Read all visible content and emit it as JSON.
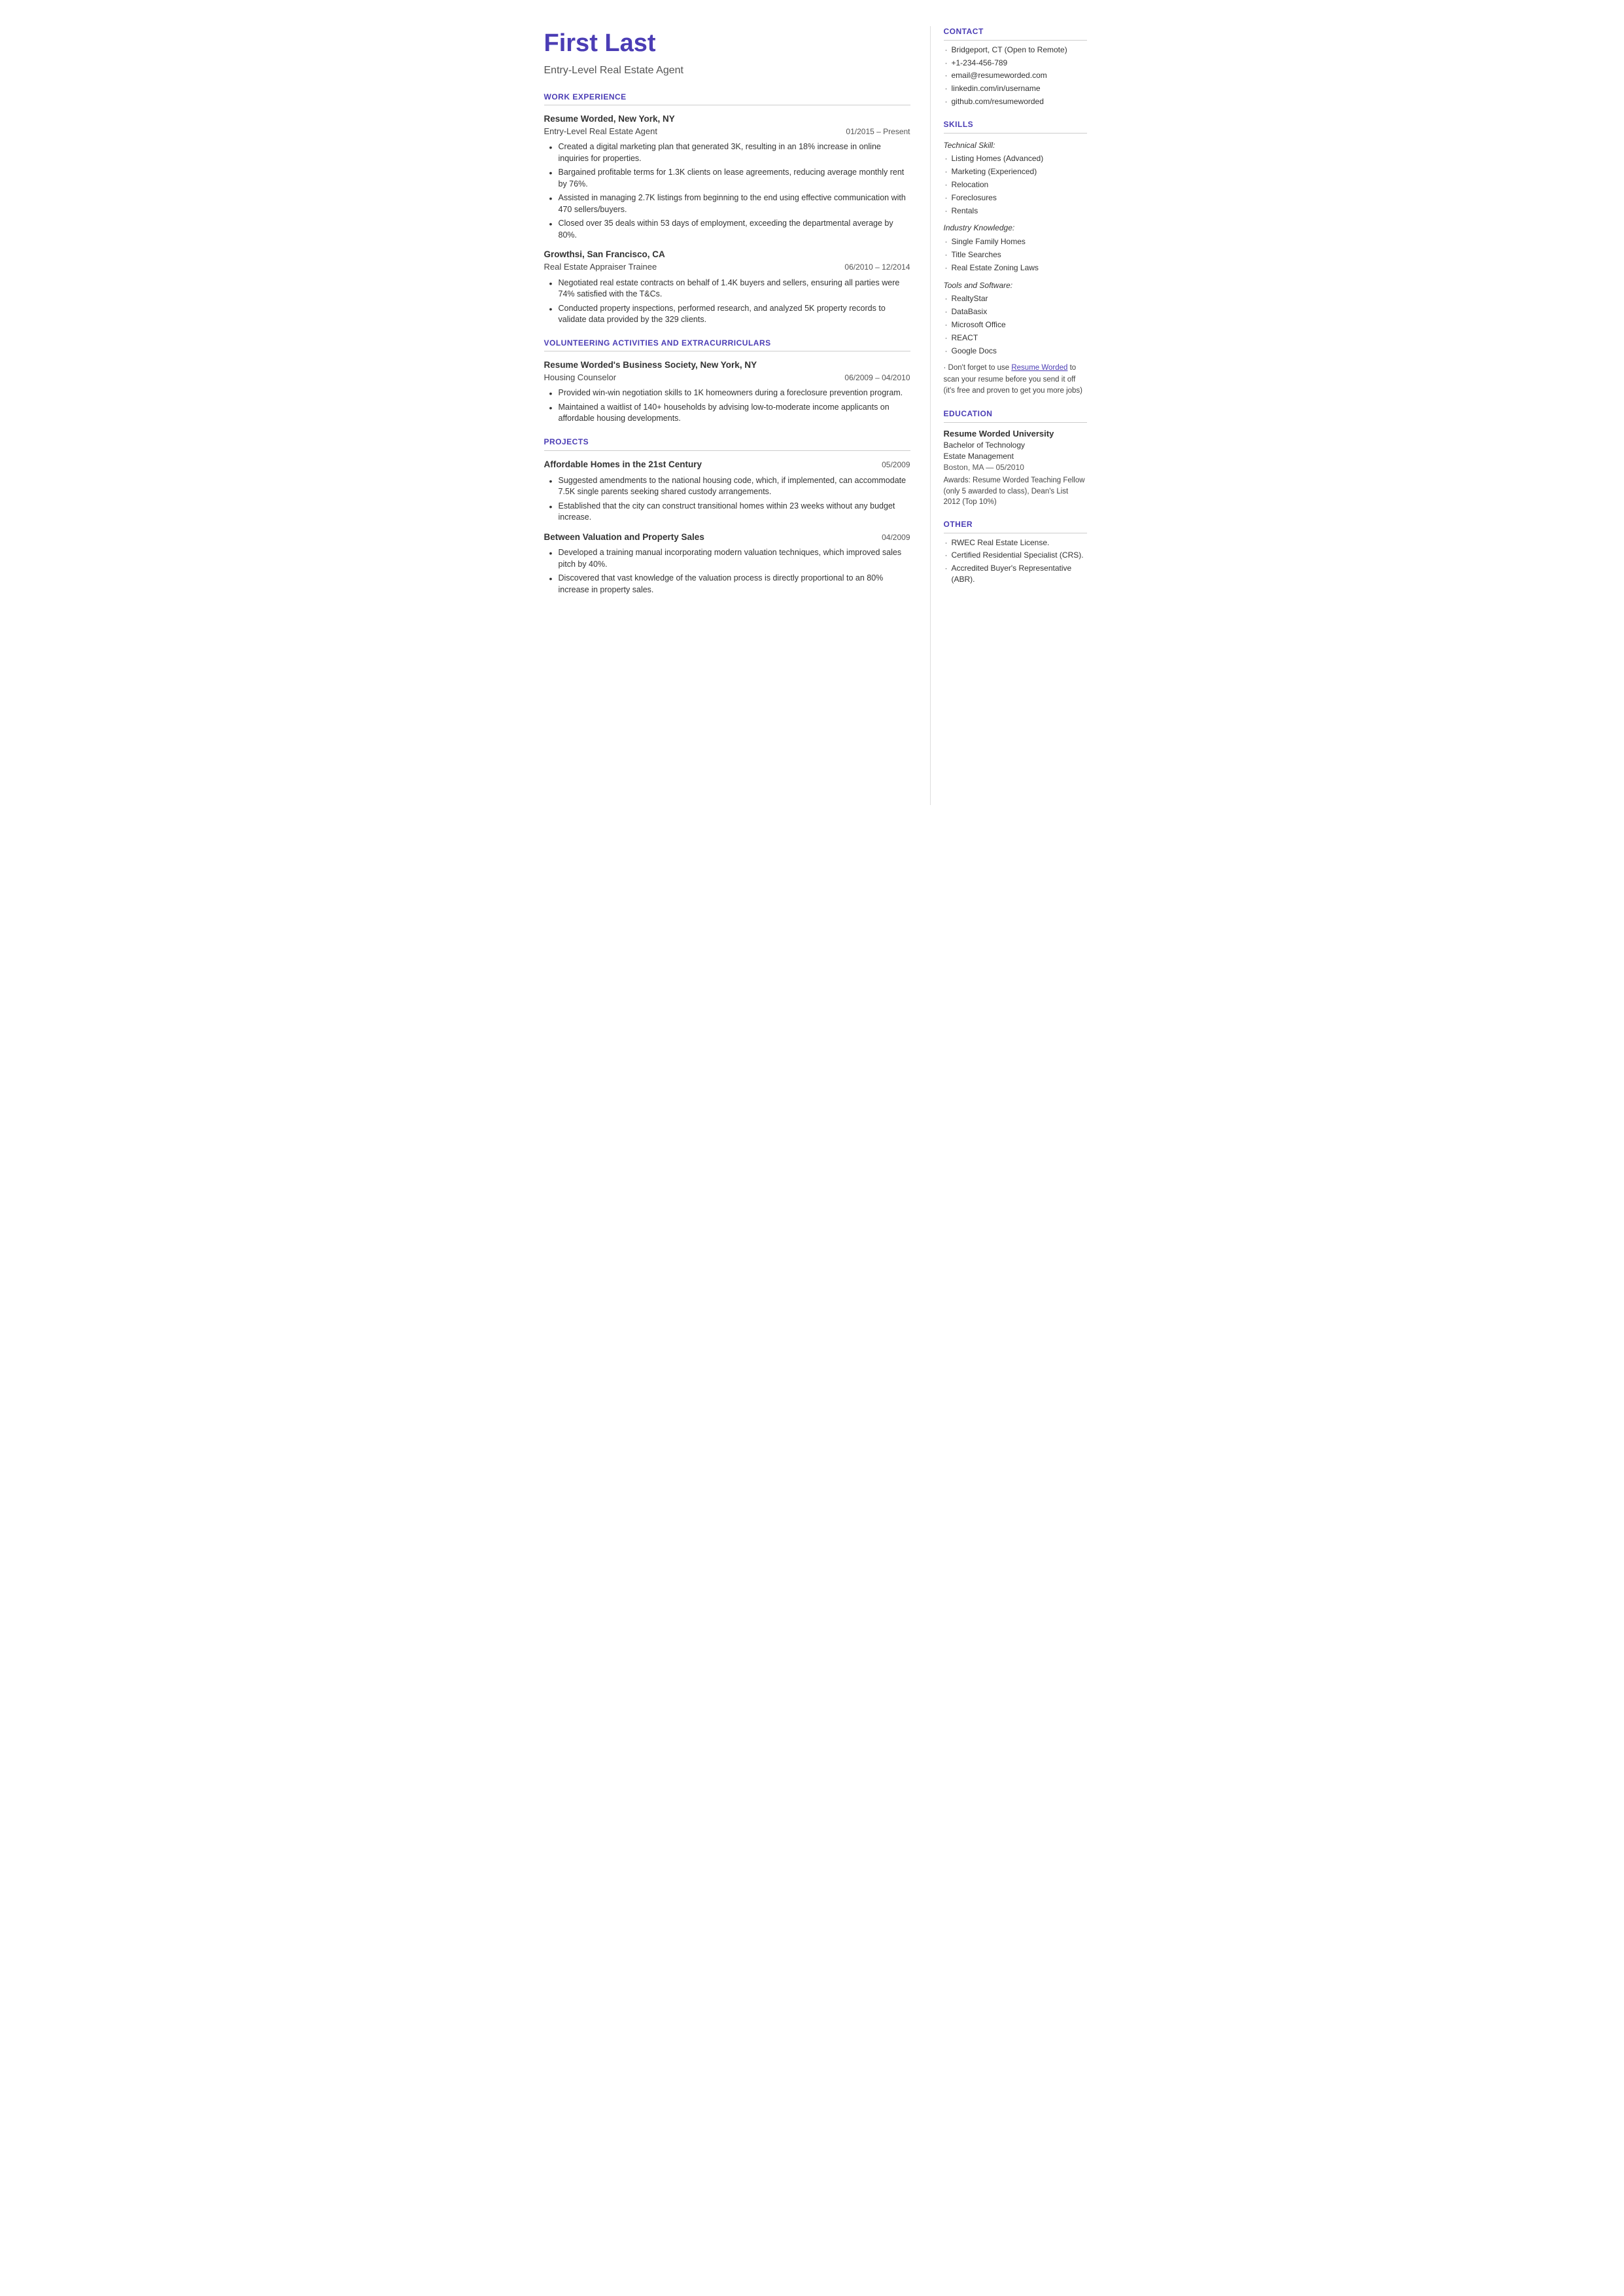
{
  "header": {
    "name": "First Last",
    "title": "Entry-Level Real Estate Agent"
  },
  "sections": {
    "work_experience_label": "WORK EXPERIENCE",
    "volunteering_label": "VOLUNTEERING ACTIVITIES AND EXTRACURRICULARS",
    "projects_label": "PROJECTS"
  },
  "jobs": [
    {
      "company": "Resume Worded, New York, NY",
      "role": "Entry-Level Real Estate Agent",
      "dates": "01/2015 – Present",
      "bullets": [
        "Created a digital marketing plan that generated 3K, resulting in an 18% increase in online inquiries for properties.",
        "Bargained profitable terms for 1.3K clients on lease agreements, reducing average monthly rent by 76%.",
        "Assisted in managing 2.7K listings from beginning to the end using effective communication with 470 sellers/buyers.",
        "Closed over 35 deals within 53 days of employment, exceeding the departmental average by 80%."
      ]
    },
    {
      "company": "Growthsi, San Francisco, CA",
      "role": "Real Estate Appraiser Trainee",
      "dates": "06/2010 – 12/2014",
      "bullets": [
        "Negotiated real estate contracts on behalf of 1.4K buyers and sellers, ensuring all parties were 74% satisfied with the T&Cs.",
        "Conducted property inspections, performed research, and analyzed 5K property records to validate data provided by the 329 clients."
      ]
    }
  ],
  "volunteering": [
    {
      "company": "Resume Worded's Business Society, New York, NY",
      "role": "Housing Counselor",
      "dates": "06/2009 – 04/2010",
      "bullets": [
        "Provided win-win negotiation skills to 1K homeowners during a foreclosure prevention program.",
        "Maintained a waitlist of 140+ households by advising low-to-moderate income applicants on affordable housing developments."
      ]
    }
  ],
  "projects": [
    {
      "title": "Affordable Homes in the 21st Century",
      "date": "05/2009",
      "bullets": [
        "Suggested amendments to the national housing code, which, if implemented, can accommodate 7.5K single parents seeking shared custody arrangements.",
        "Established that the city can construct transitional homes within 23 weeks without any budget increase."
      ]
    },
    {
      "title": "Between Valuation and Property Sales",
      "date": "04/2009",
      "bullets": [
        "Developed a training manual incorporating modern valuation techniques, which improved sales pitch by 40%.",
        "Discovered that vast knowledge of the valuation process is directly proportional to an 80% increase in property sales."
      ]
    }
  ],
  "contact": {
    "label": "CONTACT",
    "items": [
      "Bridgeport, CT (Open to Remote)",
      "+1-234-456-789",
      "email@resumeworded.com",
      "linkedin.com/in/username",
      "github.com/resumeworded"
    ]
  },
  "skills": {
    "label": "SKILLS",
    "technical_label": "Technical Skill:",
    "technical": [
      "Listing Homes (Advanced)",
      "Marketing (Experienced)",
      "Relocation",
      "Foreclosures",
      "Rentals"
    ],
    "industry_label": "Industry Knowledge:",
    "industry": [
      "Single Family Homes",
      "Title Searches",
      "Real Estate Zoning Laws"
    ],
    "tools_label": "Tools and Software:",
    "tools": [
      "RealtyStar",
      "DataBasix",
      "Microsoft Office",
      "REACT",
      "Google Docs"
    ],
    "promo": "Don't forget to use Resume Worded to scan your resume before you send it off (it's free and proven to get you more jobs)"
  },
  "education": {
    "label": "EDUCATION",
    "school": "Resume Worded University",
    "degree": "Bachelor of Technology",
    "field": "Estate Management",
    "location_date": "Boston, MA — 05/2010",
    "awards": "Awards: Resume Worded Teaching Fellow (only 5 awarded to class), Dean's List 2012 (Top 10%)"
  },
  "other": {
    "label": "OTHER",
    "items": [
      "RWEC Real Estate License.",
      "Certified Residential Specialist (CRS).",
      "Accredited Buyer's Representative (ABR)."
    ]
  }
}
